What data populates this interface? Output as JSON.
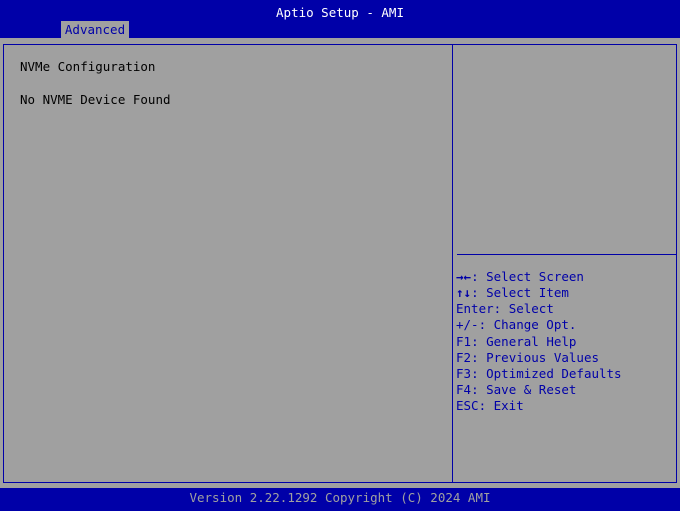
{
  "header": {
    "title": "Aptio Setup - AMI",
    "tabs": [
      {
        "label": "Advanced",
        "active": true
      }
    ]
  },
  "main": {
    "lines": [
      "NVMe Configuration",
      "No NVME Device Found"
    ]
  },
  "help": {
    "items": [
      {
        "key": "→←",
        "text": ": Select Screen"
      },
      {
        "key": "↑↓",
        "text": ": Select Item"
      },
      {
        "key": "Enter",
        "text": ": Select"
      },
      {
        "key": "+/-",
        "text": ": Change Opt."
      },
      {
        "key": "F1",
        "text": ": General Help"
      },
      {
        "key": "F2",
        "text": ": Previous Values"
      },
      {
        "key": "F3",
        "text": ": Optimized Defaults"
      },
      {
        "key": "F4",
        "text": ": Save & Reset"
      },
      {
        "key": "ESC",
        "text": ": Exit"
      }
    ]
  },
  "footer": {
    "version": "Version 2.22.1292 Copyright (C) 2024 AMI"
  },
  "colors": {
    "bios_blue": "#0000a8",
    "panel_gray": "#a0a0a0",
    "text_black": "#000000",
    "text_white": "#ffffff"
  }
}
